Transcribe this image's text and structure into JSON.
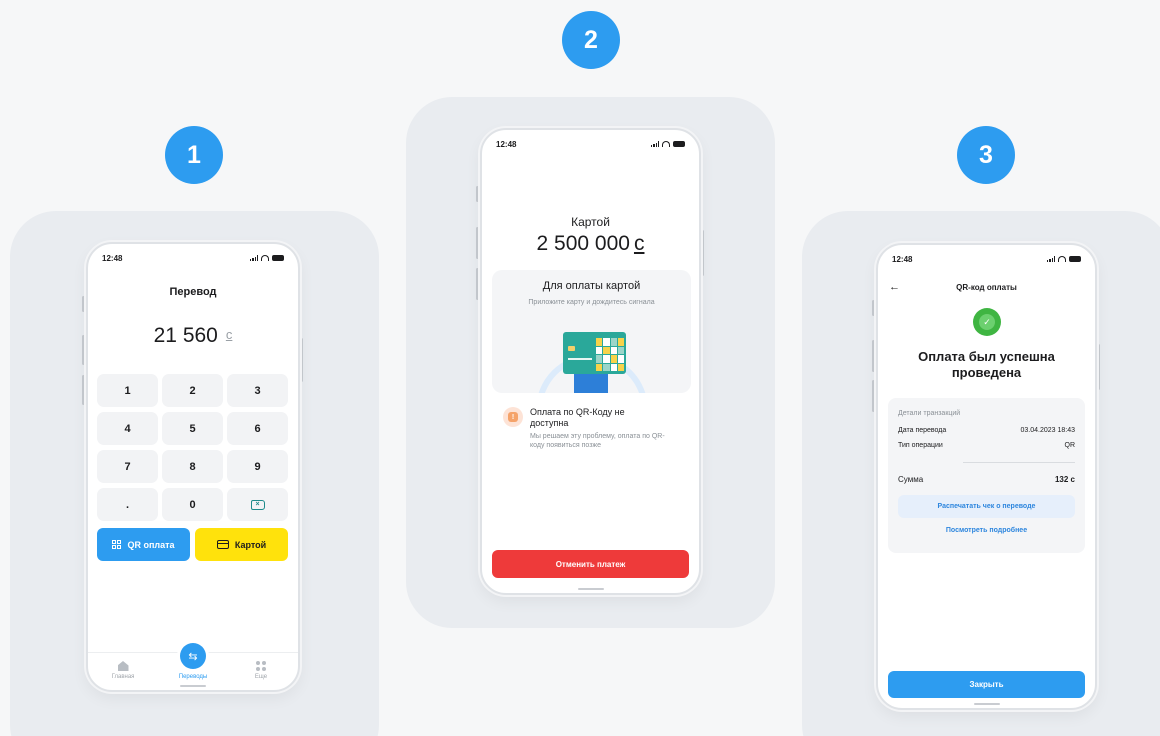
{
  "steps": [
    "1",
    "2",
    "3"
  ],
  "status_time": "12:48",
  "screen1": {
    "title": "Перевод",
    "amount": "21 560",
    "currency": "с",
    "keys": [
      "1",
      "2",
      "3",
      "4",
      "5",
      "6",
      "7",
      "8",
      "9",
      ".",
      "0"
    ],
    "qr_button": "QR оплата",
    "card_button": "Картой",
    "tabs": {
      "home": "Главная",
      "transfers": "Переводы",
      "more": "Еще"
    }
  },
  "screen2": {
    "method_label": "Картой",
    "amount": "2 500 000",
    "currency": "с",
    "box_title": "Для оплаты картой",
    "box_subtitle": "Приложите карту и дождитесь сигнала",
    "warning_title": "Оплата по QR-Коду не доступна",
    "warning_text": "Мы решаем эту проблему, оплата по QR-коду появиться позже",
    "cancel_button": "Отменить платеж"
  },
  "screen3": {
    "header": "QR-код оплаты",
    "title": "Оплата был успешна проведена",
    "section_label": "Детали транзакций",
    "rows": [
      {
        "label": "Дата перевода",
        "value": "03.04.2023 18:43"
      },
      {
        "label": "Тип операции",
        "value": "QR"
      }
    ],
    "sum_label": "Сумма",
    "sum_value": "132 с",
    "print_button": "Распечатать чек о переводе",
    "more_link": "Посмотреть подробнее",
    "close_button": "Закрыть"
  },
  "colors": {
    "accent": "#2d9cf0",
    "yellow": "#ffe20c",
    "red": "#ee3a3a",
    "success": "#3fb542",
    "panel": "#e9ecf0"
  }
}
